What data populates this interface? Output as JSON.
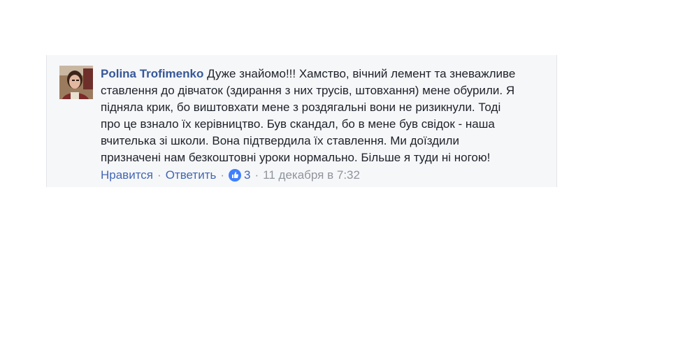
{
  "comment": {
    "author": "Polina Trofimenko",
    "text_lines": [
      "Дуже знайомо!!! Хамство, вічний лемент та зневажливе",
      "ставлення до дівчаток (здирання з них трусів, штовхання) мене обурили. Я",
      "підняла крик, бо виштовхати мене з роздягальні вони не ризикнули. Тоді",
      "про це взнало їх керівництво. Був скандал, бо в мене був свідок - наша",
      "вчителька зі школи. Вона підтвердила їх ставлення. Ми доїздили",
      "призначені нам безкоштовні уроки нормально. Більше я туди ні ногою!"
    ],
    "actions": {
      "like_label": "Нравится",
      "separator": "·",
      "reply_label": "Ответить",
      "reaction_count": "3",
      "timestamp": "11 декабря в 7:32"
    },
    "avatar_icon": "user-avatar-photo",
    "like_icon": "thumbs-up-icon"
  },
  "colors": {
    "author": "#365899",
    "link": "#4267b2",
    "meta": "#90949c",
    "text": "#1d2129",
    "card_bg": "#f6f7f9",
    "like_badge": "#4080ff"
  }
}
